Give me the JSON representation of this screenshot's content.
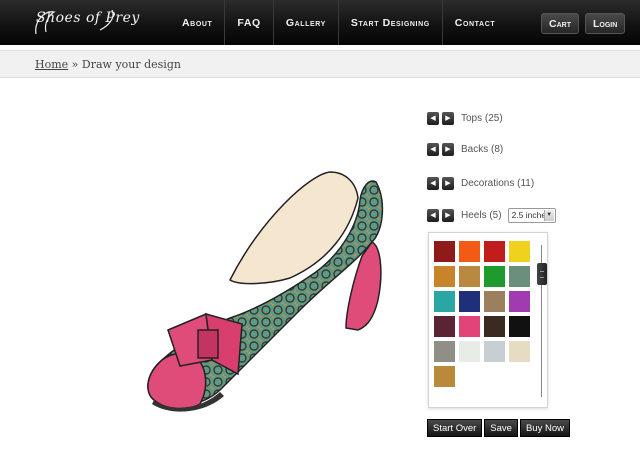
{
  "header": {
    "logo_text": "Shoes of Prey",
    "nav": [
      "About",
      "FAQ",
      "Gallery",
      "Start Designing",
      "Contact"
    ],
    "cart_label": "Cart",
    "login_label": "Login"
  },
  "breadcrumb": {
    "home": "Home",
    "separator": " » ",
    "current": "Draw your design"
  },
  "options": {
    "tops": "Tops (25)",
    "backs": "Backs (8)",
    "decorations": "Decorations (11)",
    "heels": "Heels (5)",
    "heel_height": "2.5 inche"
  },
  "swatches": [
    "#8e1a1a",
    "#f25a16",
    "#c21d1d",
    "#f0d21e",
    "#c8842a",
    "#b8893f",
    "#1e9a2e",
    "#6a8f7a",
    "#2aa7a5",
    "#1f2f7a",
    "#9b7f5f",
    "#a13bb0",
    "#5a2434",
    "#e2447a",
    "#3a2a22",
    "#111111",
    "#8f8f88",
    "#e8ece6",
    "#c7cfd2",
    "#e6dcc2",
    "#b88a3a"
  ],
  "selected_swatch": 13,
  "actions": {
    "start_over": "Start Over",
    "save": "Save",
    "buy_now": "Buy Now"
  }
}
